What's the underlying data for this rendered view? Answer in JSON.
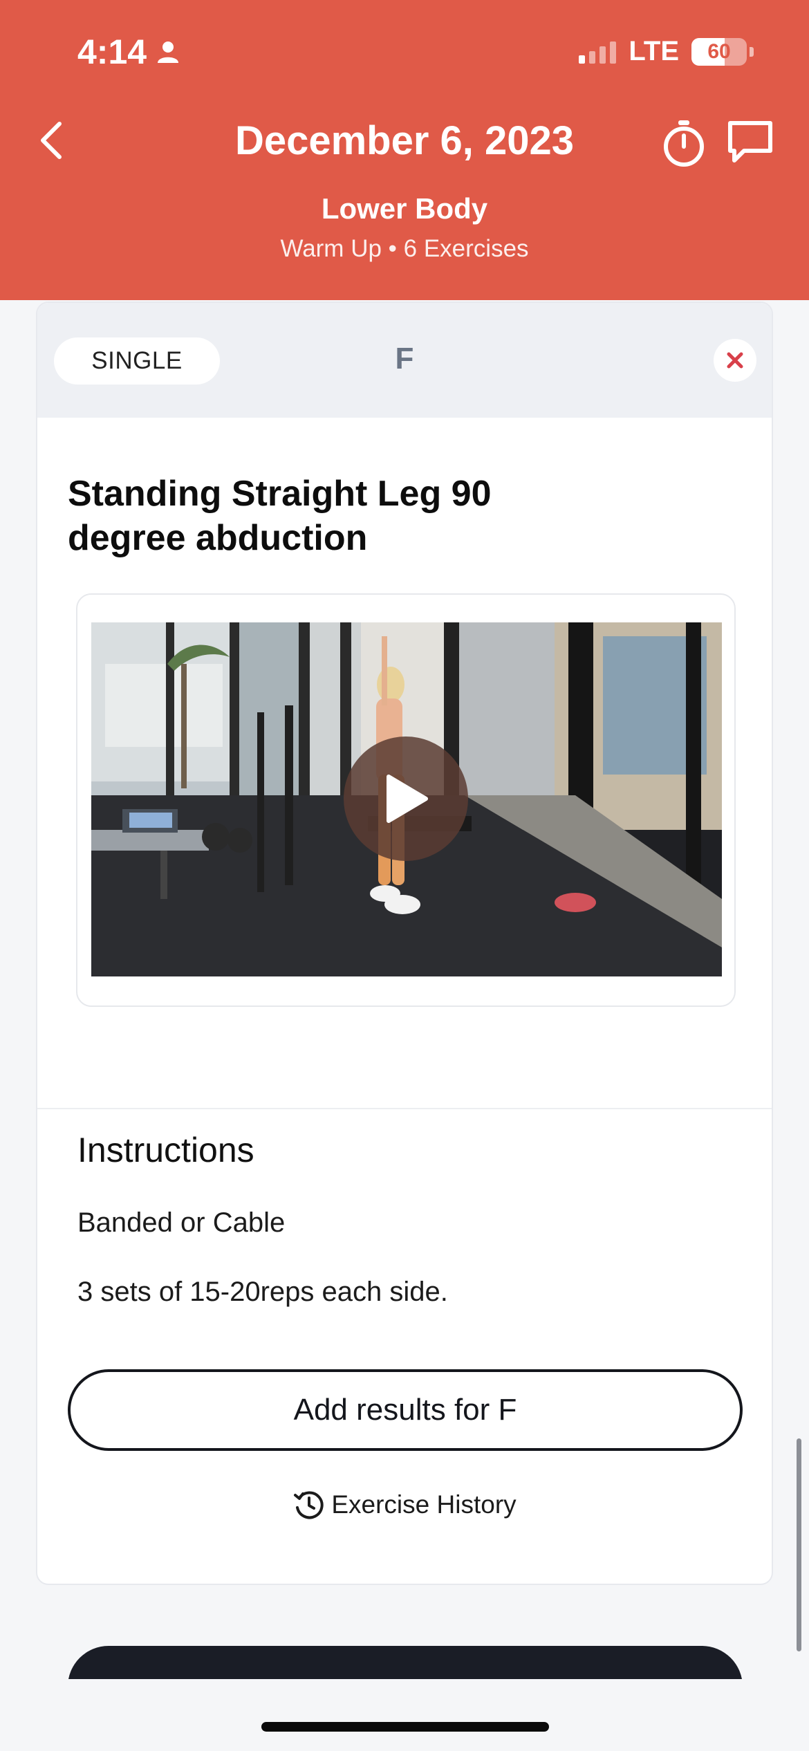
{
  "status_bar": {
    "time": "4:14",
    "network": "LTE",
    "battery": "60",
    "battery_level": 0.6
  },
  "header": {
    "title": "December 6, 2023",
    "workout_name": "Lower Body",
    "workout_meta": "Warm Up • 6 Exercises",
    "background_color": "#e05a48"
  },
  "exercise_card": {
    "type_label": "SINGLE",
    "letter": "F",
    "title": "Standing Straight Leg 90 degree abduction",
    "video": {
      "icon": "play-icon"
    },
    "instructions_heading": "Instructions",
    "instructions": [
      "Banded or Cable",
      "3 sets of 15-20reps each side."
    ],
    "add_results_label": "Add results for F",
    "history_label": "Exercise History"
  },
  "icons": {
    "back": "chevron-left-icon",
    "timer": "stopwatch-icon",
    "chat": "chat-bubble-icon",
    "close": "close-icon",
    "history": "history-clock-icon",
    "person": "person-icon"
  },
  "colors": {
    "accent": "#e05a48",
    "close_x": "#d8404a",
    "dark": "#14161c"
  }
}
